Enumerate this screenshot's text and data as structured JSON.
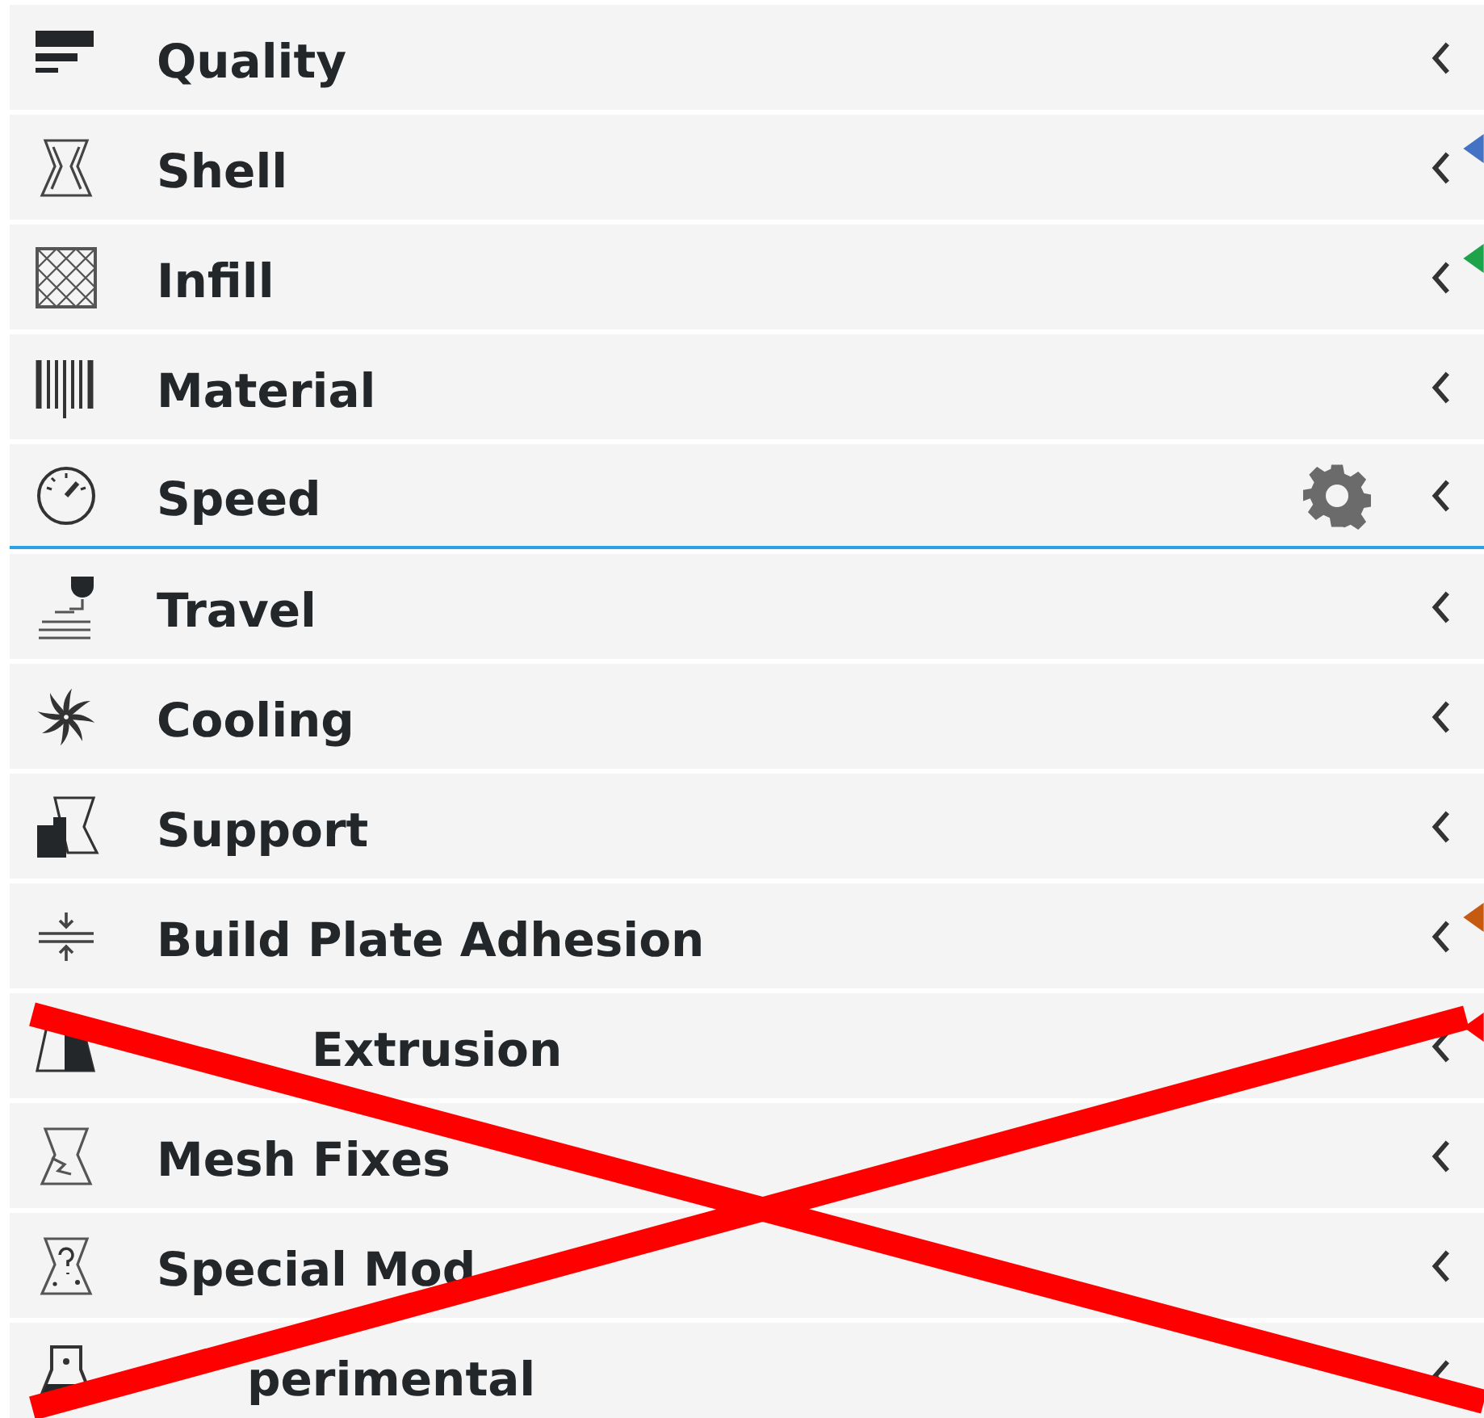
{
  "settings_categories": [
    {
      "label": "Quality",
      "hovered": false
    },
    {
      "label": "Shell",
      "hovered": false,
      "arrow": {
        "color": "#4472c4"
      }
    },
    {
      "label": "Infill",
      "hovered": false,
      "arrow": {
        "color": "#1fa34a"
      }
    },
    {
      "label": "Material",
      "hovered": false
    },
    {
      "label": "Speed",
      "hovered": true
    },
    {
      "label": "Travel",
      "hovered": false
    },
    {
      "label": "Cooling",
      "hovered": false
    },
    {
      "label": "Support",
      "hovered": false
    },
    {
      "label": "Build Plate Adhesion",
      "hovered": false,
      "arrow": {
        "color": "#c55a11"
      }
    },
    {
      "label": "Extrusion",
      "hovered": false,
      "arrow": {
        "color": "#ff0000"
      }
    },
    {
      "label": "Mesh Fixes",
      "hovered": false
    },
    {
      "label": "Special Mod",
      "hovered": false
    },
    {
      "label": "perimental",
      "hovered": false
    }
  ],
  "overlay": {
    "kind": "cross-out"
  }
}
